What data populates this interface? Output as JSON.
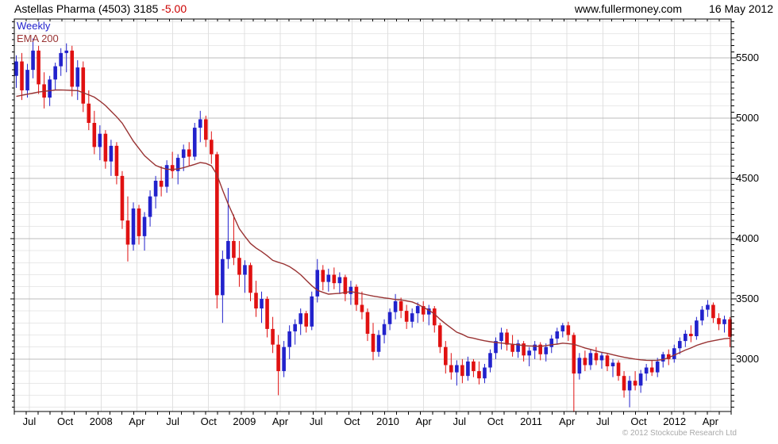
{
  "header": {
    "instrument": "Astellas Pharma (4503) 3185",
    "change": " -5.00",
    "site": "www.fullermoney.com",
    "date": "16 May 2012"
  },
  "legend": {
    "timeframe": "Weekly",
    "indicator": "EMA 200"
  },
  "footer": {
    "copyright": "© 2012 Stockcube Research Ltd"
  },
  "colors": {
    "up": "#2222cc",
    "down": "#e01111",
    "ema": "#993333",
    "grid_minor": "#e9e9e9",
    "grid_major": "#bdbdbd",
    "grid_vert": "#e0e0e0",
    "axis": "#000000",
    "change_negative": "#cc0000"
  },
  "chart_data": {
    "type": "candlestick",
    "title": "Astellas Pharma (4503)",
    "last_price": 3185,
    "last_change": -5.0,
    "timeframe": "Weekly",
    "overlay": "EMA 200",
    "ylim": [
      2565,
      5822
    ],
    "y_ticks": [
      3000,
      3500,
      4000,
      4500,
      5000,
      5500
    ],
    "y_minor_grid_step": 100,
    "y_minor_tick_step": 50,
    "x_tick_labels": [
      "Jul",
      "Oct",
      "2008",
      "Apr",
      "Jul",
      "Oct",
      "2009",
      "Apr",
      "Jul",
      "Oct",
      "2010",
      "Apr",
      "Jul",
      "Oct",
      "2011",
      "Apr",
      "Jul",
      "Oct",
      "2012",
      "Apr"
    ],
    "x_tick_fractions": [
      0.021,
      0.071,
      0.121,
      0.171,
      0.221,
      0.271,
      0.321,
      0.371,
      0.421,
      0.471,
      0.521,
      0.571,
      0.621,
      0.671,
      0.721,
      0.771,
      0.821,
      0.871,
      0.921,
      0.971
    ],
    "x_range_note": "Jun 2007 - May 2012, weekly data (sampled)",
    "grid": true,
    "legend_position": "top-left",
    "candles": [
      [
        5350,
        5520,
        5250,
        5470
      ],
      [
        5470,
        5540,
        5150,
        5230
      ],
      [
        5230,
        5450,
        5170,
        5400
      ],
      [
        5400,
        5660,
        5330,
        5560
      ],
      [
        5560,
        5600,
        5200,
        5280
      ],
      [
        5280,
        5380,
        5080,
        5170
      ],
      [
        5170,
        5350,
        5100,
        5320
      ],
      [
        5320,
        5460,
        5230,
        5430
      ],
      [
        5430,
        5580,
        5350,
        5540
      ],
      [
        5540,
        5620,
        5380,
        5560
      ],
      [
        5560,
        5600,
        5180,
        5260
      ],
      [
        5260,
        5480,
        5150,
        5420
      ],
      [
        5420,
        5470,
        5050,
        5120
      ],
      [
        5120,
        5230,
        4900,
        4960
      ],
      [
        4960,
        5060,
        4700,
        4760
      ],
      [
        4760,
        4940,
        4650,
        4870
      ],
      [
        4870,
        4900,
        4580,
        4640
      ],
      [
        4640,
        4820,
        4520,
        4770
      ],
      [
        4770,
        4800,
        4450,
        4520
      ],
      [
        4520,
        4560,
        4080,
        4150
      ],
      [
        4150,
        4350,
        3810,
        3950
      ],
      [
        3950,
        4300,
        3900,
        4250
      ],
      [
        4250,
        4280,
        3950,
        4020
      ],
      [
        4020,
        4220,
        3900,
        4180
      ],
      [
        4180,
        4400,
        4100,
        4350
      ],
      [
        4350,
        4520,
        4250,
        4480
      ],
      [
        4480,
        4600,
        4350,
        4430
      ],
      [
        4430,
        4650,
        4380,
        4610
      ],
      [
        4610,
        4720,
        4500,
        4560
      ],
      [
        4560,
        4700,
        4450,
        4670
      ],
      [
        4670,
        4780,
        4560,
        4740
      ],
      [
        4740,
        4800,
        4600,
        4680
      ],
      [
        4680,
        4960,
        4650,
        4920
      ],
      [
        4920,
        5060,
        4800,
        4990
      ],
      [
        4990,
        5020,
        4760,
        4820
      ],
      [
        4820,
        4890,
        4620,
        4700
      ],
      [
        4700,
        4720,
        3420,
        3530
      ],
      [
        3530,
        3900,
        3300,
        3830
      ],
      [
        3830,
        4420,
        3750,
        3980
      ],
      [
        3980,
        4200,
        3780,
        3840
      ],
      [
        3840,
        3980,
        3600,
        3700
      ],
      [
        3700,
        3820,
        3550,
        3780
      ],
      [
        3780,
        3800,
        3480,
        3550
      ],
      [
        3550,
        3650,
        3350,
        3420
      ],
      [
        3420,
        3560,
        3300,
        3500
      ],
      [
        3500,
        3520,
        3180,
        3250
      ],
      [
        3250,
        3350,
        3050,
        3120
      ],
      [
        3120,
        3200,
        2700,
        2900
      ],
      [
        2900,
        3150,
        2850,
        3100
      ],
      [
        3100,
        3280,
        3000,
        3230
      ],
      [
        3230,
        3330,
        3120,
        3290
      ],
      [
        3290,
        3420,
        3200,
        3380
      ],
      [
        3380,
        3400,
        3220,
        3270
      ],
      [
        3270,
        3560,
        3240,
        3520
      ],
      [
        3520,
        3830,
        3470,
        3740
      ],
      [
        3740,
        3780,
        3570,
        3640
      ],
      [
        3640,
        3750,
        3560,
        3700
      ],
      [
        3700,
        3760,
        3580,
        3630
      ],
      [
        3630,
        3720,
        3540,
        3680
      ],
      [
        3680,
        3700,
        3480,
        3540
      ],
      [
        3540,
        3650,
        3450,
        3600
      ],
      [
        3600,
        3620,
        3400,
        3450
      ],
      [
        3450,
        3560,
        3330,
        3390
      ],
      [
        3390,
        3420,
        3150,
        3210
      ],
      [
        3210,
        3300,
        2990,
        3060
      ],
      [
        3060,
        3240,
        3020,
        3200
      ],
      [
        3200,
        3330,
        3130,
        3290
      ],
      [
        3290,
        3420,
        3240,
        3390
      ],
      [
        3390,
        3540,
        3330,
        3480
      ],
      [
        3480,
        3510,
        3340,
        3400
      ],
      [
        3400,
        3450,
        3250,
        3310
      ],
      [
        3310,
        3420,
        3260,
        3380
      ],
      [
        3380,
        3470,
        3300,
        3440
      ],
      [
        3440,
        3480,
        3310,
        3370
      ],
      [
        3370,
        3450,
        3280,
        3420
      ],
      [
        3420,
        3440,
        3220,
        3280
      ],
      [
        3280,
        3300,
        3050,
        3100
      ],
      [
        3100,
        3150,
        2880,
        2950
      ],
      [
        2950,
        3050,
        2830,
        2890
      ],
      [
        2890,
        2990,
        2780,
        2950
      ],
      [
        2950,
        3000,
        2800,
        2860
      ],
      [
        2860,
        3020,
        2820,
        2980
      ],
      [
        2980,
        3000,
        2850,
        2900
      ],
      [
        2900,
        2980,
        2790,
        2840
      ],
      [
        2840,
        2960,
        2800,
        2930
      ],
      [
        2930,
        3080,
        2890,
        3050
      ],
      [
        3050,
        3180,
        3000,
        3150
      ],
      [
        3150,
        3260,
        3080,
        3220
      ],
      [
        3220,
        3250,
        3070,
        3120
      ],
      [
        3120,
        3200,
        3020,
        3060
      ],
      [
        3060,
        3160,
        3010,
        3130
      ],
      [
        3130,
        3150,
        2980,
        3030
      ],
      [
        3030,
        3100,
        2940,
        3070
      ],
      [
        3070,
        3150,
        3000,
        3120
      ],
      [
        3120,
        3140,
        2990,
        3040
      ],
      [
        3040,
        3130,
        2980,
        3100
      ],
      [
        3100,
        3200,
        3050,
        3170
      ],
      [
        3170,
        3260,
        3120,
        3230
      ],
      [
        3230,
        3300,
        3180,
        3280
      ],
      [
        3280,
        3310,
        3150,
        3200
      ],
      [
        3200,
        3220,
        2560,
        2880
      ],
      [
        2880,
        3050,
        2830,
        3010
      ],
      [
        3010,
        3070,
        2900,
        2950
      ],
      [
        2950,
        3080,
        2910,
        3050
      ],
      [
        3050,
        3100,
        2950,
        2990
      ],
      [
        2990,
        3060,
        2920,
        3030
      ],
      [
        3030,
        3050,
        2900,
        2940
      ],
      [
        2940,
        3000,
        2850,
        2970
      ],
      [
        2970,
        2990,
        2820,
        2860
      ],
      [
        2860,
        2900,
        2680,
        2740
      ],
      [
        2740,
        2860,
        2600,
        2820
      ],
      [
        2820,
        2900,
        2740,
        2780
      ],
      [
        2780,
        2910,
        2720,
        2880
      ],
      [
        2880,
        2960,
        2820,
        2930
      ],
      [
        2930,
        2990,
        2860,
        2890
      ],
      [
        2890,
        3010,
        2850,
        2980
      ],
      [
        2980,
        3060,
        2930,
        3040
      ],
      [
        3040,
        3080,
        2950,
        3000
      ],
      [
        3000,
        3120,
        2970,
        3090
      ],
      [
        3090,
        3180,
        3040,
        3150
      ],
      [
        3150,
        3240,
        3100,
        3210
      ],
      [
        3210,
        3280,
        3140,
        3190
      ],
      [
        3190,
        3350,
        3160,
        3320
      ],
      [
        3320,
        3440,
        3280,
        3410
      ],
      [
        3410,
        3490,
        3350,
        3450
      ],
      [
        3450,
        3470,
        3300,
        3340
      ],
      [
        3340,
        3380,
        3240,
        3290
      ],
      [
        3290,
        3360,
        3220,
        3330
      ],
      [
        3330,
        3350,
        3100,
        3185
      ]
    ],
    "ema200": [
      5180,
      5189,
      5198,
      5207,
      5216,
      5222,
      5227,
      5233,
      5234,
      5232,
      5230,
      5228,
      5210,
      5193,
      5174,
      5141,
      5104,
      5057,
      5011,
      4958,
      4883,
      4808,
      4748,
      4688,
      4647,
      4607,
      4589,
      4576,
      4574,
      4578,
      4588,
      4602,
      4616,
      4631,
      4624,
      4604,
      4530,
      4403,
      4287,
      4184,
      4082,
      4018,
      3959,
      3922,
      3892,
      3857,
      3819,
      3803,
      3789,
      3768,
      3736,
      3700,
      3654,
      3609,
      3571,
      3554,
      3539,
      3543,
      3546,
      3553,
      3560,
      3551,
      3542,
      3532,
      3523,
      3515,
      3508,
      3502,
      3494,
      3491,
      3483,
      3474,
      3455,
      3430,
      3406,
      3374,
      3330,
      3293,
      3258,
      3223,
      3205,
      3182,
      3173,
      3162,
      3152,
      3144,
      3138,
      3133,
      3128,
      3123,
      3119,
      3112,
      3109,
      3107,
      3106,
      3112,
      3119,
      3124,
      3132,
      3128,
      3123,
      3108,
      3092,
      3080,
      3067,
      3056,
      3047,
      3036,
      3025,
      3015,
      3007,
      3000,
      2994,
      2990,
      2989,
      2990,
      2996,
      3012,
      3033,
      3054,
      3075,
      3092,
      3114,
      3129,
      3143,
      3152,
      3161,
      3169,
      3172
    ]
  }
}
